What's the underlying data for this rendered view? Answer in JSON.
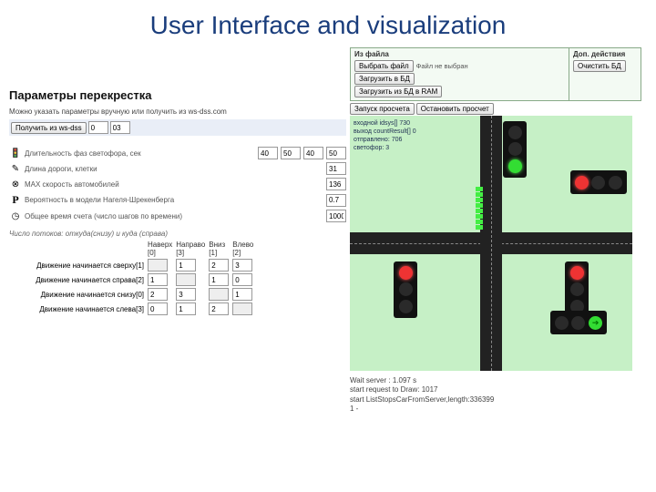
{
  "title": "User Interface and visualization",
  "left_panel": {
    "heading": "Параметры перекрестка",
    "sub": "Можно указать параметры вручную или получить из ws-dss.com",
    "get_btn": "Получить из ws-dss",
    "get_val1": "0",
    "get_val2": "03",
    "params": [
      {
        "icon": "traffic",
        "label": "Длительность фаз светофора, сек",
        "vals": [
          "40",
          "50",
          "40",
          "50"
        ]
      },
      {
        "icon": "pencil",
        "label": "Длина дороги, клетки",
        "vals": [
          "31"
        ]
      },
      {
        "icon": "circle-x",
        "label": "MAX скорость автомобилей",
        "vals": [
          "136"
        ]
      },
      {
        "icon": "P",
        "label": "Вероятность в модели Нагеля-Шрекенберга",
        "vals": [
          "0.7"
        ]
      },
      {
        "icon": "clock",
        "label": "Общее время счета (число шагов по времени)",
        "vals": [
          "1000"
        ]
      }
    ],
    "flows_sub": "Число потоков: откуда(снизу) и куда (справа)",
    "flow_headers": [
      "Наверх [0]",
      "Направо [3]",
      "Вниз [1]",
      "Влево [2]"
    ],
    "flow_rows": [
      {
        "label": "Движение начинается сверху[1]",
        "vals": [
          "",
          "1",
          "2",
          "3"
        ]
      },
      {
        "label": "Движение начинается справа[2]",
        "vals": [
          "1",
          "",
          "1",
          "0"
        ]
      },
      {
        "label": "Движение начинается снизу[0]",
        "vals": [
          "2",
          "3",
          "",
          "1"
        ]
      },
      {
        "label": "Движение начинается слева[3]",
        "vals": [
          "0",
          "1",
          "2",
          ""
        ]
      }
    ]
  },
  "right_panel": {
    "file": {
      "left_title": "Из файла",
      "choose_btn": "Выбрать файл",
      "no_file": "Файл не выбран",
      "load_btn": "Загрузить в БД",
      "ram_btn": "Загрузить из БД в RAM",
      "right_title": "Доп. действия",
      "clear_btn": "Очистить БД"
    },
    "sim_bar": {
      "start": "Запуск просчета",
      "stop": "Остановить просчет"
    },
    "stats": {
      "l1": "входной idsys[] 730",
      "l2": "выход countResult[] 0",
      "l3": "отправлено: 706",
      "l4": "светофор: 3"
    },
    "status": {
      "l1": "Wait server  : 1.097 s",
      "l2": "start request to Draw: 1017",
      "l3": "start ListStopsCarFromServer,length:336399",
      "l4": "1 -"
    }
  }
}
